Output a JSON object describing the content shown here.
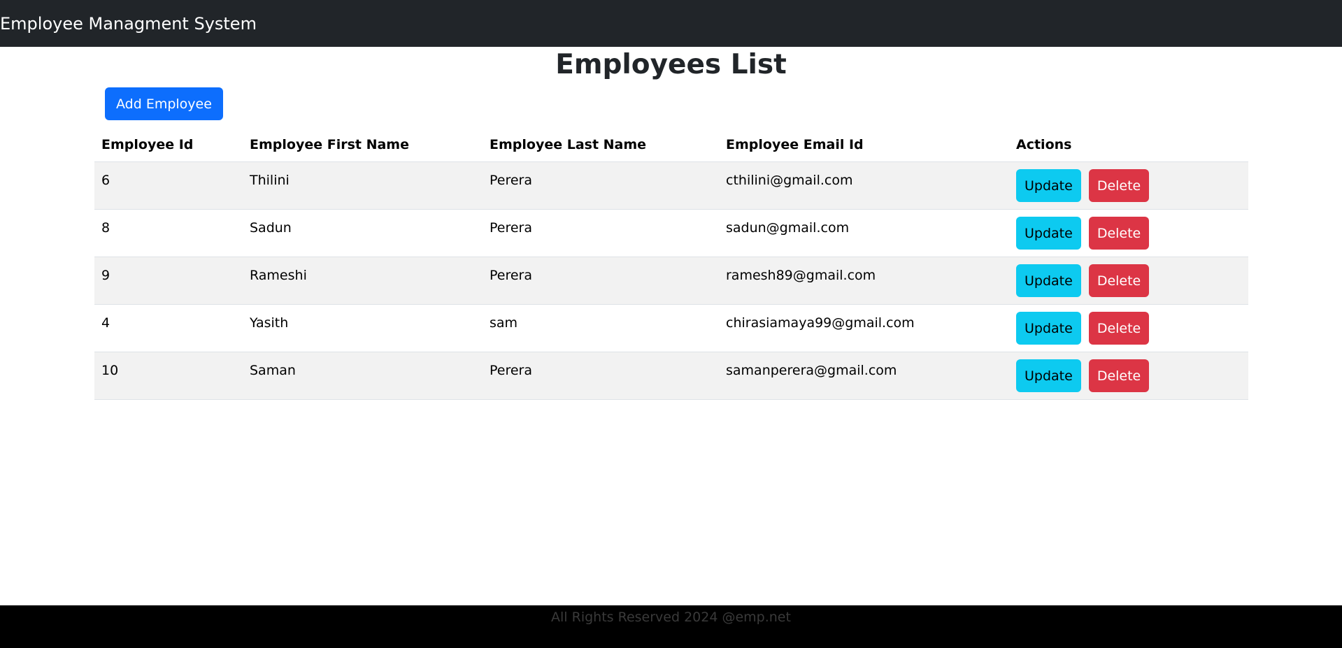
{
  "navbar": {
    "brand": "Employee Managment System"
  },
  "page": {
    "title": "Employees List",
    "add_button_label": "Add Employee"
  },
  "table": {
    "headers": {
      "id": "Employee Id",
      "first_name": "Employee First Name",
      "last_name": "Employee Last Name",
      "email": "Employee Email Id",
      "actions": "Actions"
    },
    "rows": [
      {
        "id": "6",
        "first_name": "Thilini",
        "last_name": "Perera",
        "email": "cthilini@gmail.com"
      },
      {
        "id": "8",
        "first_name": "Sadun",
        "last_name": "Perera",
        "email": "sadun@gmail.com"
      },
      {
        "id": "9",
        "first_name": "Rameshi",
        "last_name": "Perera",
        "email": "ramesh89@gmail.com"
      },
      {
        "id": "4",
        "first_name": "Yasith",
        "last_name": "sam",
        "email": "chirasiamaya99@gmail.com"
      },
      {
        "id": "10",
        "first_name": "Saman",
        "last_name": "Perera",
        "email": "samanperera@gmail.com"
      }
    ],
    "update_label": "Update",
    "delete_label": "Delete"
  },
  "footer": {
    "text": "All Rights Reserved 2024 @emp.net"
  },
  "colors": {
    "navbar": "#212529",
    "primary": "#0d6efd",
    "info": "#0dcaf0",
    "danger": "#dc3545",
    "footer": "#000000"
  }
}
